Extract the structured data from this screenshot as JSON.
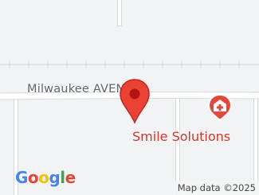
{
  "map": {
    "colors": {
      "background": "#f1f3f4",
      "road": "#ffffff",
      "road_edge": "#d7dadd",
      "marker": "#ea4335",
      "marker_dot": "#b31412",
      "poi": "#e5473b",
      "poi_label": "#d93025"
    },
    "road_label": "Milwaukee AVENUE",
    "marker": {
      "icon": "map-pin-icon"
    },
    "poi": {
      "icon": "medical-cross-icon",
      "label": "Smile Solutions"
    },
    "logo": {
      "text": "Google",
      "letter_colors": [
        "#4285f4",
        "#ea4335",
        "#fbbc05",
        "#4285f4",
        "#34a853",
        "#ea4335"
      ]
    },
    "attribution": "Map data ©2025"
  }
}
